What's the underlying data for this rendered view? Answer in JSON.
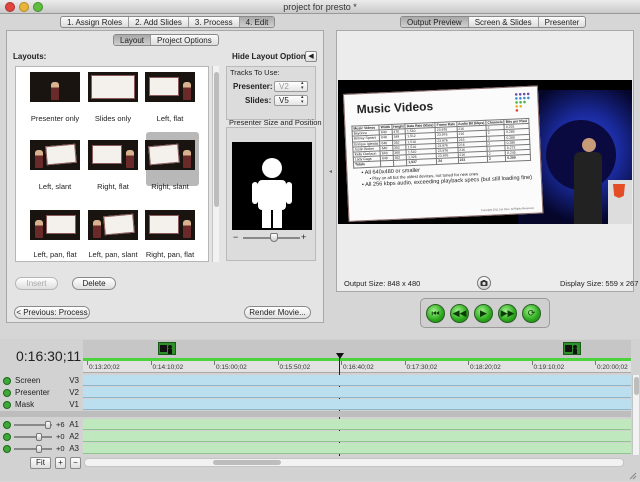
{
  "window": {
    "title": "project for presto *"
  },
  "steps": [
    "1. Assign Roles",
    "2. Add Slides",
    "3. Process",
    "4. Edit"
  ],
  "active_step": 3,
  "left_tabs": [
    "Layout",
    "Project Options"
  ],
  "layouts": {
    "heading": "Layouts:",
    "items": [
      {
        "label": "Presenter only"
      },
      {
        "label": "Slides only"
      },
      {
        "label": "Left, flat"
      },
      {
        "label": "Left, slant"
      },
      {
        "label": "Right, flat"
      },
      {
        "label": "Right, slant"
      },
      {
        "label": "Left, pan, flat"
      },
      {
        "label": "Left, pan, slant"
      },
      {
        "label": "Right, pan, flat"
      }
    ],
    "selected": "Right, slant"
  },
  "options": {
    "hide_label": "Hide Layout Options",
    "tracks_heading": "Tracks To Use:",
    "presenter_label": "Presenter:",
    "presenter_value": "V2",
    "slides_label": "Slides:",
    "slides_value": "V5",
    "size_heading": "Presenter Size and Position",
    "zoom_minus": "−",
    "zoom_plus": "+"
  },
  "buttons": {
    "insert": "Insert",
    "delete": "Delete",
    "previous": "< Previous: Process",
    "render": "Render Movie..."
  },
  "right_tabs": [
    "Output Preview",
    "Screen & Slides",
    "Presenter"
  ],
  "preview": {
    "slide_title": "Music Videos",
    "table_headers": [
      "Music Videos",
      "Width",
      "Height",
      "Data Rate (kbps)",
      "Frame Rate",
      "Audio Bit (kbps)",
      "Channels",
      "Bits per Pixel"
    ],
    "table_rows": [
      [
        "Beyonce",
        "640",
        "470",
        "1,510",
        "23.976",
        "216",
        "2",
        "0.201"
      ],
      [
        "Britney Spears",
        "640",
        "349",
        "1,512",
        "23.976",
        "216",
        "2",
        "0.285"
      ],
      [
        "Enrique Iglesias",
        "640",
        "352",
        "1,510",
        "23.976",
        "216",
        "2",
        "0.280"
      ],
      [
        "Justin Bieber",
        "640",
        "352",
        "1,510",
        "23.976",
        "216",
        "2",
        "0.280"
      ],
      [
        "Kelly Clarkson",
        "640",
        "360",
        "1,510",
        "23.976",
        "216",
        "2",
        "0.273"
      ],
      [
        "Lady Gaga",
        "640",
        "352",
        "1,326",
        "23.976",
        "216",
        "2",
        "0.245"
      ],
      [
        "Totals",
        "",
        "",
        "1,537",
        "24",
        "231",
        "2",
        "0.200"
      ]
    ],
    "bullets": [
      "All 640x480 or smaller",
      "Play on all but the oldest devices, not tuned for new ones",
      "All 256 kbps audio, exceeding playback specs (but still loading fine)"
    ],
    "footer": "Copyright 2011 Jan Ozer. All Rights Reserved.",
    "output_size": "Output Size: 848 x 480",
    "display_size": "Display Size: 559 x 267"
  },
  "transport": [
    "rewind",
    "step-back",
    "play",
    "step-forward",
    "fast-forward"
  ],
  "timeline": {
    "timecode": "0:16:30;11",
    "ruler": [
      "0:13:20;02",
      "0:14:10;02",
      "0:15:00;02",
      "0:15:50;02",
      "0:16:40;02",
      "0:17:30;02",
      "0:18:20;02",
      "0:19:10;02",
      "0:20:00;02"
    ],
    "video_tracks": [
      {
        "name": "Screen",
        "code": "V3"
      },
      {
        "name": "Presenter",
        "code": "V2"
      },
      {
        "name": "Mask",
        "code": "V1"
      }
    ],
    "audio_tracks": [
      {
        "gain": "+6",
        "code": "A1",
        "level": 0.85
      },
      {
        "gain": "+0",
        "code": "A2",
        "level": 0.6
      },
      {
        "gain": "+0",
        "code": "A3",
        "level": 0.6
      }
    ],
    "fit_label": "Fit",
    "zoom_in": "+",
    "zoom_out": "−"
  },
  "colors": {
    "accent_green": "#3ea83a",
    "video_lane": "#bcdff0",
    "audio_lane": "#bfe8bf"
  }
}
